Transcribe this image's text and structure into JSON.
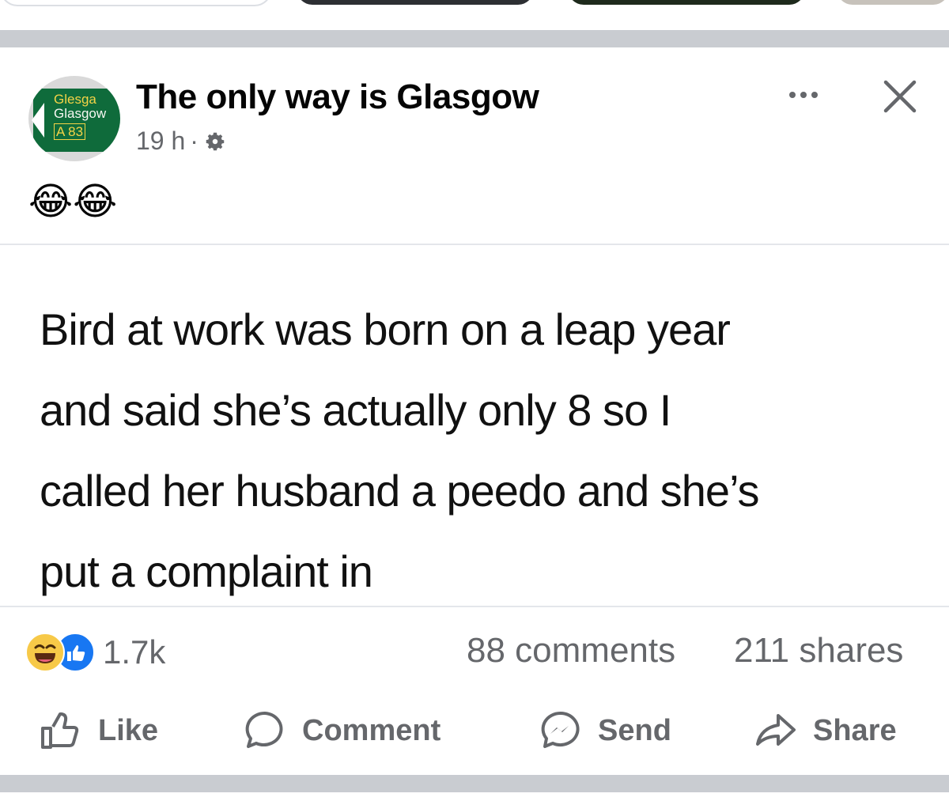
{
  "post": {
    "page_name": "The only way is Glasgow",
    "time": "19 h",
    "dot": "·",
    "avatar_sign_lines": [
      "Glesga",
      "Glasgow",
      "A 83"
    ],
    "caption": "😂😂",
    "text_lines": [
      "Bird at work was born on a leap year",
      "and said she’s actually only 8 so I",
      "called her husband a peedo and she’s",
      "put a complaint in"
    ]
  },
  "stats": {
    "reaction_count": "1.7k",
    "comments": "88 comments",
    "shares": "211 shares"
  },
  "actions": {
    "like": "Like",
    "comment": "Comment",
    "send": "Send",
    "share": "Share"
  },
  "icons": [
    "gear-icon",
    "more-icon",
    "close-icon",
    "haha-reaction-icon",
    "like-reaction-icon",
    "like-icon",
    "comment-icon",
    "messenger-icon",
    "share-icon"
  ],
  "colors": {
    "secondary_text": "#65676b",
    "separator": "#c9ccd1",
    "like_blue": "#1877f2",
    "haha_yellow": "#f7c948"
  }
}
